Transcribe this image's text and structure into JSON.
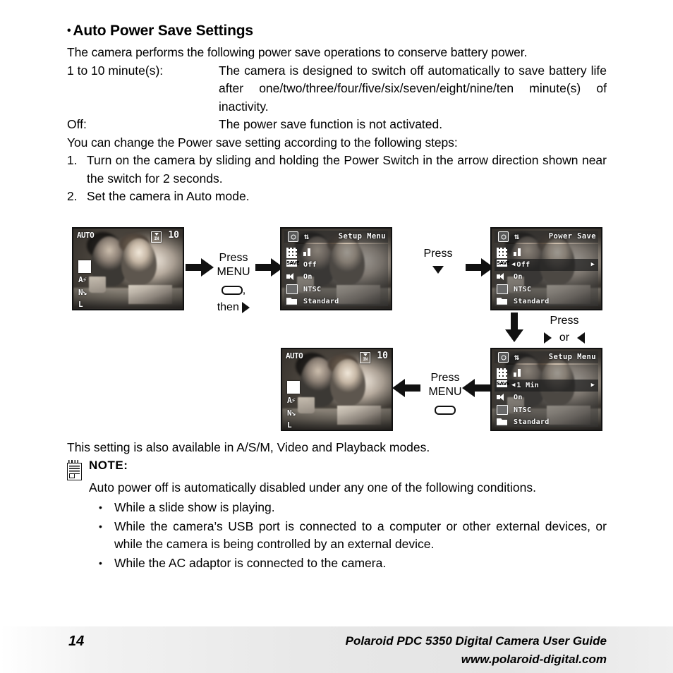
{
  "section": {
    "bullet": "•",
    "title": "Auto Power Save Settings",
    "intro": "The camera performs the following power save operations to conserve battery power.",
    "definitions": [
      {
        "term": "1 to 10 minute(s):",
        "desc": "The camera is designed to switch off automatically to save battery life after one/two/three/four/five/six/seven/eight/nine/ten minute(s) of inactivity."
      },
      {
        "term": "Off:",
        "desc": "The power save function is not activated."
      }
    ],
    "lead_in": "You can change the Power save setting according to the following steps:",
    "steps": [
      {
        "num": "1.",
        "text": "Turn on the camera by sliding and holding the Power Switch in the arrow direction shown near the switch for 2 seconds."
      },
      {
        "num": "2.",
        "text": "Set the camera in Auto mode."
      }
    ]
  },
  "diagram": {
    "screen_live_top": {
      "mode": "AUTO",
      "count": "10",
      "memory_label": "IN",
      "indicators": {
        "drive": "single-shot",
        "flash": "A",
        "quality": "N",
        "size": "L"
      }
    },
    "screen_setup_menu": {
      "title": "Setup Menu",
      "rows": [
        {
          "icon": "resolution-icon",
          "value": ""
        },
        {
          "icon": "power-save-icon",
          "value": "Off"
        },
        {
          "icon": "sound-icon",
          "value": "On"
        },
        {
          "icon": "video-out-icon",
          "value": "NTSC"
        },
        {
          "icon": "folder-icon",
          "value": "Standard"
        }
      ],
      "selected_index": -1
    },
    "screen_power_save": {
      "title": "Power Save",
      "rows": [
        {
          "icon": "resolution-icon",
          "value": ""
        },
        {
          "icon": "power-save-icon",
          "value": "Off"
        },
        {
          "icon": "sound-icon",
          "value": "On"
        },
        {
          "icon": "video-out-icon",
          "value": "NTSC"
        },
        {
          "icon": "folder-icon",
          "value": "Standard"
        }
      ],
      "selected_index": 1,
      "arrow_left": "◀",
      "arrow_right": "▶"
    },
    "screen_setup_menu_1min": {
      "title": "Setup Menu",
      "rows": [
        {
          "icon": "resolution-icon",
          "value": ""
        },
        {
          "icon": "power-save-icon",
          "value": "1 Min"
        },
        {
          "icon": "sound-icon",
          "value": "On"
        },
        {
          "icon": "video-out-icon",
          "value": "NTSC"
        },
        {
          "icon": "folder-icon",
          "value": "Standard"
        }
      ],
      "selected_index": 1,
      "arrow_left": "◀",
      "arrow_right": "▶"
    },
    "screen_live_bottom": {
      "mode": "AUTO",
      "count": "10",
      "memory_label": "IN",
      "indicators": {
        "drive": "single-shot",
        "flash": "A",
        "quality": "N",
        "size": "L"
      }
    },
    "labels": {
      "press_menu_then": {
        "line1": "Press",
        "line2": "MENU",
        "line3_suffix": ",",
        "line4": "then"
      },
      "press_down": {
        "line1": "Press"
      },
      "press_lr": {
        "line1": "Press",
        "mid": "or"
      },
      "press_menu_back": {
        "line1": "Press",
        "line2": "MENU"
      }
    }
  },
  "availability": "This setting is also available in A/S/M, Video and Playback modes.",
  "note": {
    "title": "NOTE:",
    "body": "Auto power off is automatically disabled under any one of the following conditions.",
    "bullet": "•",
    "items": [
      "While a slide show is playing.",
      "While the camera’s USB port is connected to a computer or other external devices, or while the camera is being controlled by an external device.",
      "While the AC adaptor is connected to the camera."
    ]
  },
  "footer": {
    "page_number": "14",
    "line1": "Polaroid PDC 5350 Digital Camera User Guide",
    "line2": "www.polaroid-digital.com"
  }
}
